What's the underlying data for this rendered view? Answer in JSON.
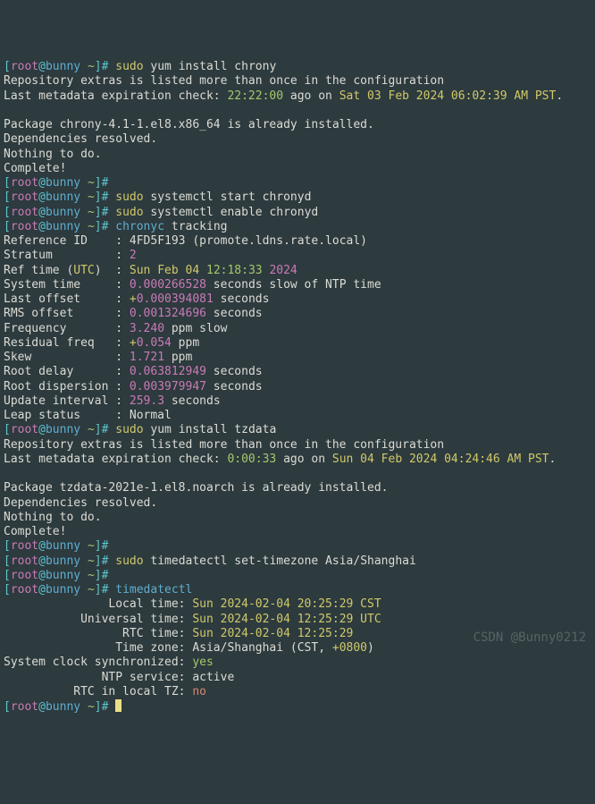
{
  "prompt": {
    "open": "[",
    "user": "root",
    "at": "@",
    "host": "bunny",
    "space": " ",
    "tilde": "~",
    "close": "]# "
  },
  "cmd": {
    "sudo": "sudo",
    "yum_install_chrony": "yum install chrony",
    "systemctl_start": "systemctl start chronyd",
    "systemctl_enable": "systemctl enable chronyd",
    "chronyc_tracking": "chronyc tracking",
    "yum_install_tzdata": "yum install tzdata",
    "timedatectl_set": "timedatectl set-timezone Asia/Shanghai",
    "timedatectl": "timedatectl"
  },
  "s1": {
    "repo": "Repository extras is listed more than once in the configuration",
    "meta_pre": "Last metadata expiration check: ",
    "meta_time": "22:22:00",
    "meta_mid": " ago on ",
    "meta_date": "Sat 03 Feb 2024 06:02:39 AM PST",
    "dot": ".",
    "blank": "",
    "pkg": "Package chrony-4.1-1.el8.x86_64 is already installed.",
    "deps": "Dependencies resolved.",
    "nothing": "Nothing to do.",
    "complete": "Complete!"
  },
  "tracking": {
    "refid_l": "Reference ID    : ",
    "refid_v": "4FD5F193 (promote.ldns.rate.local)",
    "stratum_l": "Stratum         : ",
    "stratum_v": "2",
    "reftime_l": "Ref time (",
    "utc": "UTC",
    "reftime_l2": ")  : ",
    "ref_day": "Sun Feb 04 ",
    "ref_t": "12:18:33 ",
    "ref_y": "2024",
    "systime_l": "System time     : ",
    "systime_v": "0.000266528",
    "systime_s": " seconds slow of NTP time",
    "lastoff_l": "Last offset     : ",
    "lastoff_sign": "+",
    "lastoff_v": "0.000394081",
    "lastoff_s": " seconds",
    "rms_l": "RMS offset      : ",
    "rms_v": "0.001324696",
    "rms_s": " seconds",
    "freq_l": "Frequency       : ",
    "freq_v": "3.240",
    "freq_s": " ppm slow",
    "resid_l": "Residual freq   : ",
    "resid_sign": "+",
    "resid_v": "0.054",
    "resid_s": " ppm",
    "skew_l": "Skew            : ",
    "skew_v": "1.721",
    "skew_s": " ppm",
    "rootdel_l": "Root delay      : ",
    "rootdel_v": "0.063812949",
    "rootdel_s": " seconds",
    "rootdis_l": "Root dispersion : ",
    "rootdis_v": "0.003979947",
    "rootdis_s": " seconds",
    "upd_l": "Update interval : ",
    "upd_v": "259.3",
    "upd_s": " seconds",
    "leap_l": "Leap status     : Normal"
  },
  "s2": {
    "repo": "Repository extras is listed more than once in the configuration",
    "meta_pre": "Last metadata expiration check: ",
    "meta_time": "0:00:33",
    "meta_mid": " ago on ",
    "meta_date": "Sun 04 Feb 2024 04:24:46 AM PST",
    "dot": ".",
    "pkg": "Package tzdata-2021e-1.el8.noarch is already installed.",
    "deps": "Dependencies resolved.",
    "nothing": "Nothing to do.",
    "complete": "Complete!"
  },
  "td": {
    "local_l": "               Local time: ",
    "local_v": "Sun 2024-02-04 20:25:29 CST",
    "uni_l": "           Universal time: ",
    "uni_v": "Sun 2024-02-04 12:25:29 UTC",
    "rtc_l": "                 RTC time: ",
    "rtc_v": "Sun 2024-02-04 12:25:29",
    "tz_l": "                Time zone: ",
    "tz_v": "Asia/Shanghai (CST, ",
    "tz_off": "+0800",
    "tz_end": ")",
    "sync_l": "System clock synchronized: ",
    "sync_v": "yes",
    "ntp_l": "              NTP service: ",
    "ntp_v": "active",
    "rtctz_l": "          RTC in local TZ: ",
    "rtctz_v": "no"
  },
  "watermark": "CSDN @Bunny0212"
}
